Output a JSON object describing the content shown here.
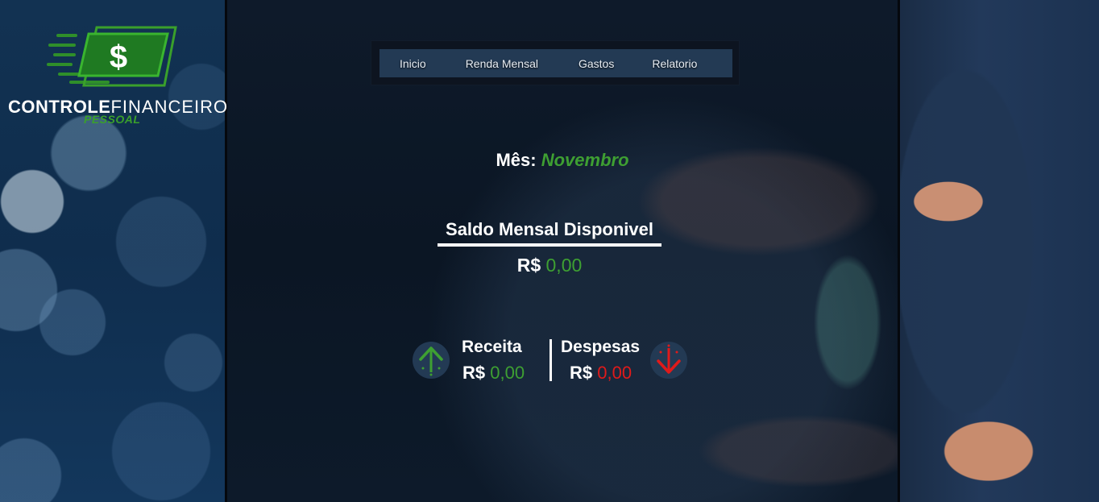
{
  "logo": {
    "title_bold": "CONTROLE",
    "title_light": "FINANCEIRO",
    "subtitle": "PESSOAL",
    "symbol": "$",
    "icon": "banknote-dollar-icon"
  },
  "nav": {
    "items": [
      {
        "label": "Inicio"
      },
      {
        "label": "Renda Mensal"
      },
      {
        "label": "Gastos"
      },
      {
        "label": "Relatorio"
      }
    ]
  },
  "month": {
    "prefix": "Mês:",
    "name": "Novembro"
  },
  "saldo": {
    "title": "Saldo Mensal Disponivel",
    "currency": "R$",
    "value": "0,00"
  },
  "receita": {
    "label": "Receita",
    "currency": "R$",
    "value": "0,00",
    "icon": "arrow-up-icon"
  },
  "despesas": {
    "label": "Despesas",
    "currency": "R$",
    "value": "0,00",
    "icon": "arrow-down-icon"
  },
  "colors": {
    "accent_green": "#3ea032",
    "accent_red": "#e01a1a",
    "nav_bg": "#233a54"
  }
}
